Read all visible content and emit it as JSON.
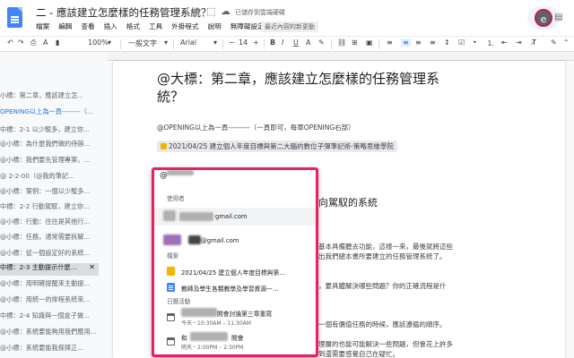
{
  "titlebar": {
    "doc_title": "二 - 應該建立怎麼樣的任務管理系統？",
    "saved_status": "已儲存到雲端硬碟",
    "last_edit": "最近內容的新更動",
    "avatar_letter": "e",
    "menu": [
      "檔案",
      "編輯",
      "查看",
      "插入",
      "格式",
      "工具",
      "外掛程式",
      "說明",
      "無障礙設定"
    ]
  },
  "toolbar": {
    "zoom": "100%",
    "style": "一般文字",
    "font": "Arial",
    "font_size": "14"
  },
  "outline": {
    "items": [
      "小標：第二章，應該建立怎...",
      "OPENING以上為一頁--------（...",
      "中標：2-1 以少駁多，建立你...",
      "@小標：為什麼我們做的待辦...",
      "@小標：我們要先管理專案，...",
      "@ 2-2-00（@我的筆記...",
      "@小標：案例：一個以少駁多...",
      "中標：2-2 行動駕馭，建立你...",
      "@小標：行動：往往是其他行...",
      "@小標：任務，通常需要拆解...",
      "@小標：從一個設定好的系統...",
      "中標：2-3 主動提示什麼...",
      "@小標：用明確提醒來主動提...",
      "@小標：用統一的排程系統來...",
      "中標：2-4 知識與一個盒子做...",
      "@小標：系統要能夠用我們應用...",
      "@小標：系統要能我探擇正..."
    ],
    "active_index": 11
  },
  "document": {
    "heading": "@大標：第二章，應該建立怎麼樣的任務管理系統？",
    "opening_line": "@OPENING以上為一頁---------（一頁即可，每章OPENING右部）",
    "linked_file_chip": "2021/04/25 建立個人年度目標與第二大腦的數位子彈筆記術-策略思維學院",
    "bg_heading_fragment": "向駕馭的系統",
    "bg_lines": [
      "基本具備聽去功能，這樣一來，最後就將這些",
      "出我們總本書所要建立的任務管理系統了。",
      "，要具體解決哪些問題？你的正確流程是什",
      "一個有價值任務的時候，應該遵循的順序。",
      "理層的也能可能解決一些問題，但會花上許多",
      "到還需要感覺自己在疑忙。"
    ]
  },
  "mention_popup": {
    "typed": "@",
    "section_users": "使用者",
    "user1_email": "gmail.com",
    "user2_email": "@gmail.com",
    "section_files": "檔案",
    "file1": "2021/04/25 建立個人年度目標與第...",
    "file2": "教師及學生各類教學及學習資源—...",
    "section_events": "日曆活動",
    "event1_title": "開會討論第三章重寫",
    "event1_time": "今天・10:30AM – 11:30AM",
    "event2_title": "開會",
    "event2_prefix": "和",
    "event2_time": "明天・2:00PM – 2:30PM"
  }
}
